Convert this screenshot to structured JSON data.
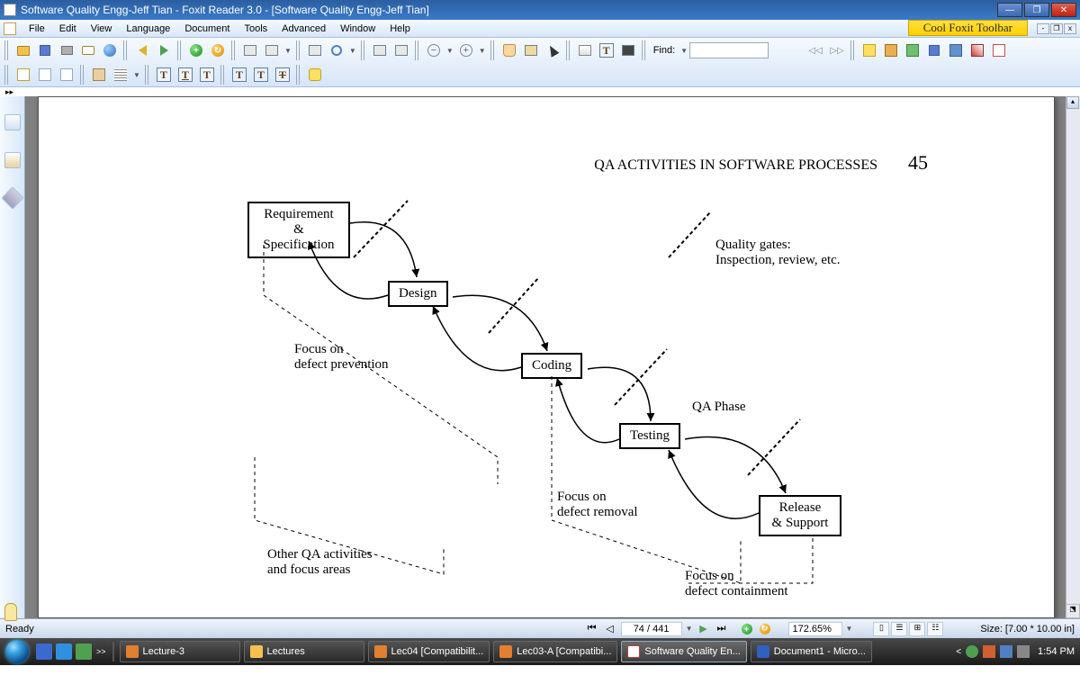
{
  "title": "Software Quality Engg-Jeff Tian - Foxit Reader 3.0 - [Software Quality Engg-Jeff Tian]",
  "cool_toolbar": "Cool Foxit Toolbar",
  "menu": {
    "file": "File",
    "edit": "Edit",
    "view": "View",
    "language": "Language",
    "document": "Document",
    "tools": "Tools",
    "advanced": "Advanced",
    "window": "Window",
    "help": "Help"
  },
  "find": {
    "label": "Find:",
    "value": ""
  },
  "page_header": {
    "title": "QA ACTIVITIES IN SOFTWARE PROCESSES",
    "page_no": "45"
  },
  "diagram": {
    "boxes": {
      "req": "Requirement\n& Specification",
      "design": "Design",
      "coding": "Coding",
      "testing": "Testing",
      "release": "Release\n& Support"
    },
    "labels": {
      "qgates1": "Quality gates:",
      "qgates2": "Inspection, review, etc.",
      "prevent1": "Focus on",
      "prevent2": "defect prevention",
      "removal1": "Focus on",
      "removal2": "defect removal",
      "contain1": "Focus on",
      "contain2": "defect containment",
      "other1": "Other QA activities",
      "other2": "and focus areas",
      "qaphase": "QA Phase"
    }
  },
  "status": {
    "ready": "Ready",
    "page": "74 / 441",
    "zoom": "172.65%",
    "size": "Size: [7.00 * 10.00 in]"
  },
  "taskbar": {
    "items": [
      "Lecture-3",
      "Lectures",
      "Lec04 [Compatibilit...",
      "Lec03-A [Compatibi...",
      "Software Quality En...",
      "Document1 - Micro..."
    ],
    "clock": "1:54 PM",
    "expand": ">>",
    "tray_expand": "<"
  }
}
